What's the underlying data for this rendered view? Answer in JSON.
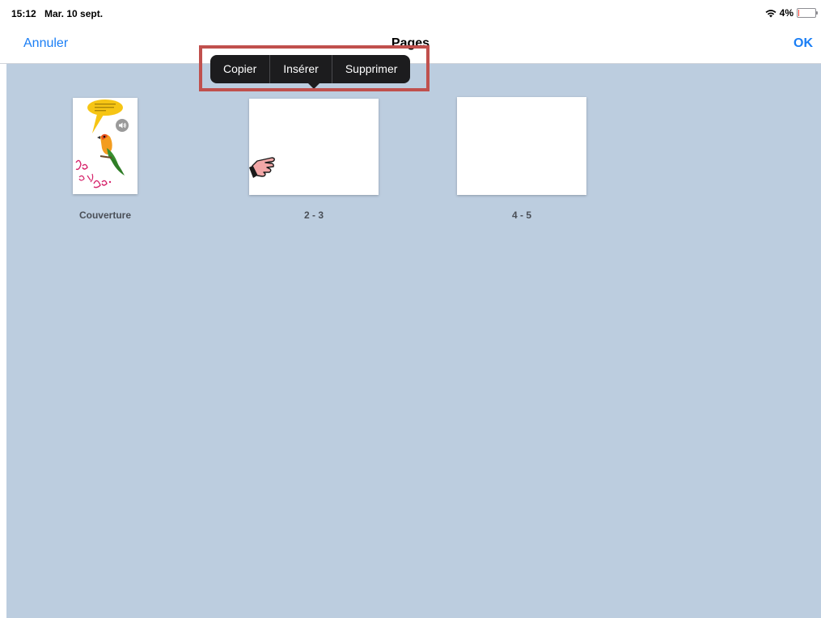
{
  "status": {
    "time": "15:12",
    "date": "Mar. 10 sept.",
    "battery": "4%",
    "battery_level": 0.04,
    "icons": {
      "wifi": "wifi-icon",
      "battery": "battery-icon"
    }
  },
  "nav": {
    "cancel": "Annuler",
    "title": "Pages",
    "ok": "OK"
  },
  "menu": {
    "items": [
      "Copier",
      "Insérer",
      "Supprimer"
    ]
  },
  "pages": [
    {
      "label": "Couverture",
      "cover_text": "Je suis Jojo."
    },
    {
      "label": "2 - 3"
    },
    {
      "label": "4 - 5"
    }
  ],
  "colors": {
    "accent": "#1a7ef5",
    "canvas": "#bccddf",
    "highlight": "#c0504d",
    "menu_bg": "#1c1c1e"
  }
}
